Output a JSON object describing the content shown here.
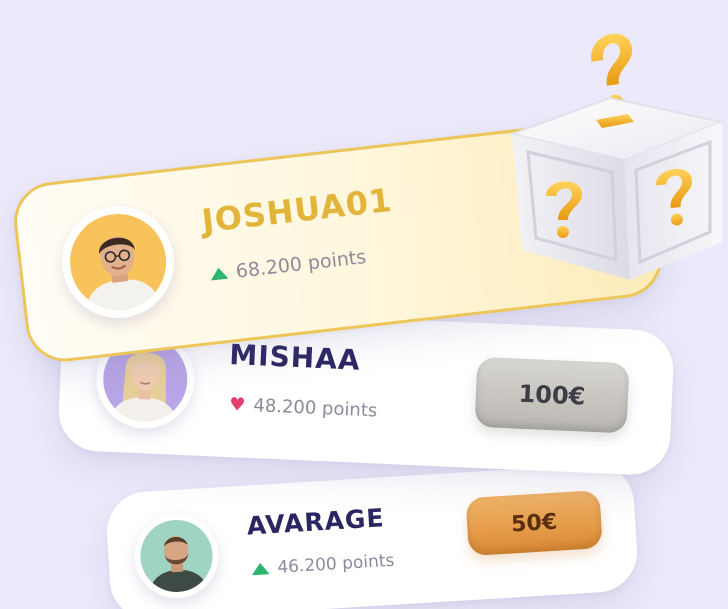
{
  "leaderboard": [
    {
      "username": "JOSHUA01",
      "points": "68.200 points",
      "trend": "up",
      "avatar_icon": "man-glasses-avatar",
      "highlight_color": "#e2b43a"
    },
    {
      "username": "MISHAA",
      "points": "48.200 points",
      "trend": "heart",
      "avatar_icon": "woman-blonde-avatar",
      "prize": "100€",
      "prize_color": "#c9c7c0"
    },
    {
      "username": "AVARAGE",
      "points": "46.200 points",
      "trend": "up",
      "avatar_icon": "man-beard-avatar",
      "prize": "50€",
      "prize_color": "#e59a45"
    }
  ],
  "decoration": {
    "mystery_box_icon": "question-mark-gift-box",
    "accent_gold": "#f4b52c",
    "name_color": "#2b2663",
    "up_color": "#2fb46f",
    "heart_color": "#e33d6e"
  }
}
